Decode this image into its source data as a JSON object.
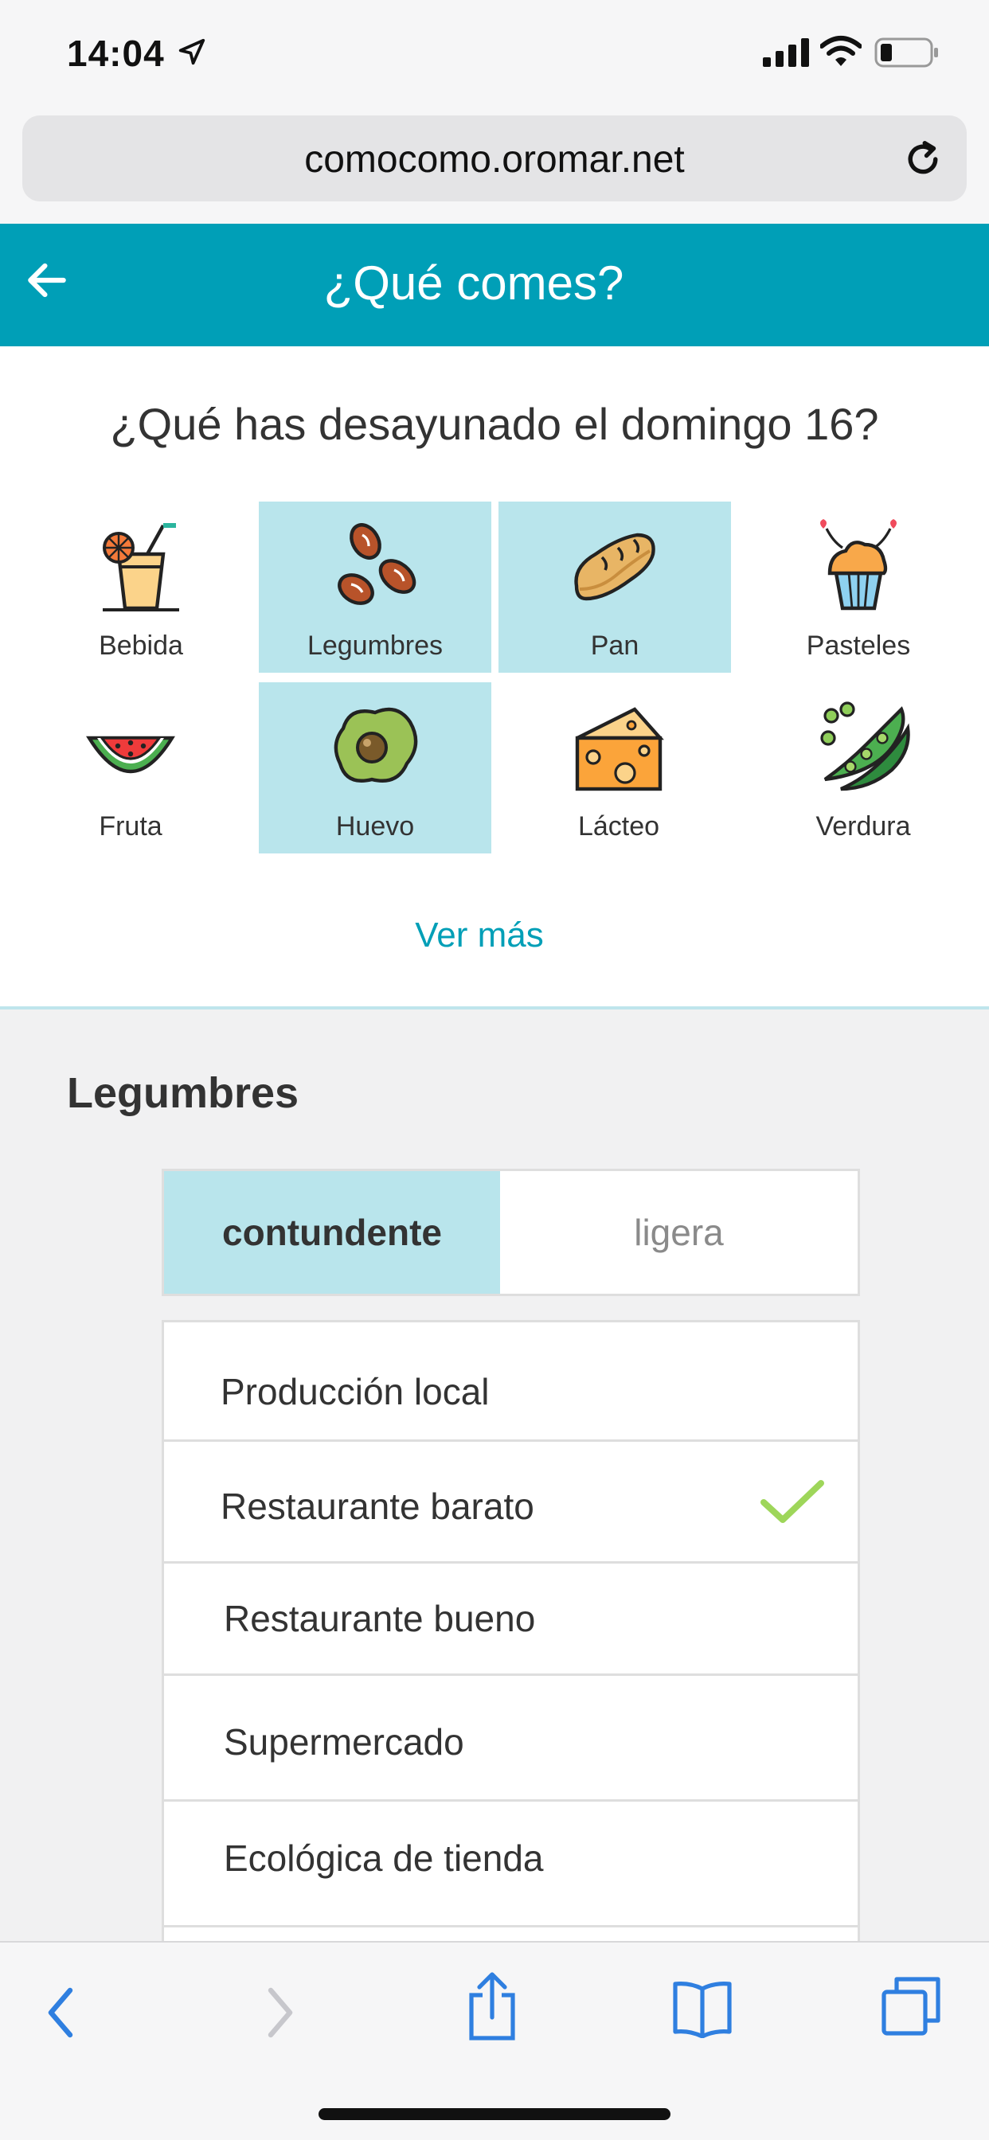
{
  "status": {
    "time": "14:04",
    "icons": [
      "location-arrow-icon",
      "cellular-signal-icon",
      "wifi-icon",
      "battery-icon"
    ]
  },
  "browser": {
    "url": "comocomo.oromar.net",
    "reload_icon": "reload-icon"
  },
  "header": {
    "title": "¿Qué comes?",
    "back_icon": "back-arrow-icon",
    "color": "#009fb7"
  },
  "question": "¿Qué has desayunado el domingo 16?",
  "foods": [
    {
      "label": "Bebida",
      "icon": "drink-icon",
      "selected": false
    },
    {
      "label": "Legumbres",
      "icon": "beans-icon",
      "selected": true
    },
    {
      "label": "Pan",
      "icon": "bread-icon",
      "selected": true
    },
    {
      "label": "Pasteles",
      "icon": "cupcake-icon",
      "selected": false
    },
    {
      "label": "Fruta",
      "icon": "watermelon-icon",
      "selected": false
    },
    {
      "label": "Huevo",
      "icon": "egg-icon",
      "selected": true
    },
    {
      "label": "Lácteo",
      "icon": "cheese-icon",
      "selected": false
    },
    {
      "label": "Verdura",
      "icon": "peas-icon",
      "selected": false
    }
  ],
  "ver_mas": "Ver más",
  "section": {
    "title": "Legumbres",
    "toggle": {
      "active": "contundente",
      "inactive": "ligera"
    },
    "options": [
      {
        "label": "Producción local",
        "checked": false
      },
      {
        "label": "Restaurante barato",
        "checked": true
      },
      {
        "label": "Restaurante bueno",
        "checked": false
      },
      {
        "label": "Supermercado",
        "checked": false
      },
      {
        "label": "Ecológica de tienda",
        "checked": false
      }
    ]
  },
  "toolbar": {
    "icons": [
      "back-chevron-icon",
      "forward-chevron-icon",
      "share-icon",
      "bookmarks-icon",
      "tabs-icon"
    ]
  },
  "colors": {
    "accent": "#009fb7",
    "selected_tile": "#b9e5ec",
    "check": "#9ed65a",
    "ios_blue": "#2f7fe0"
  }
}
